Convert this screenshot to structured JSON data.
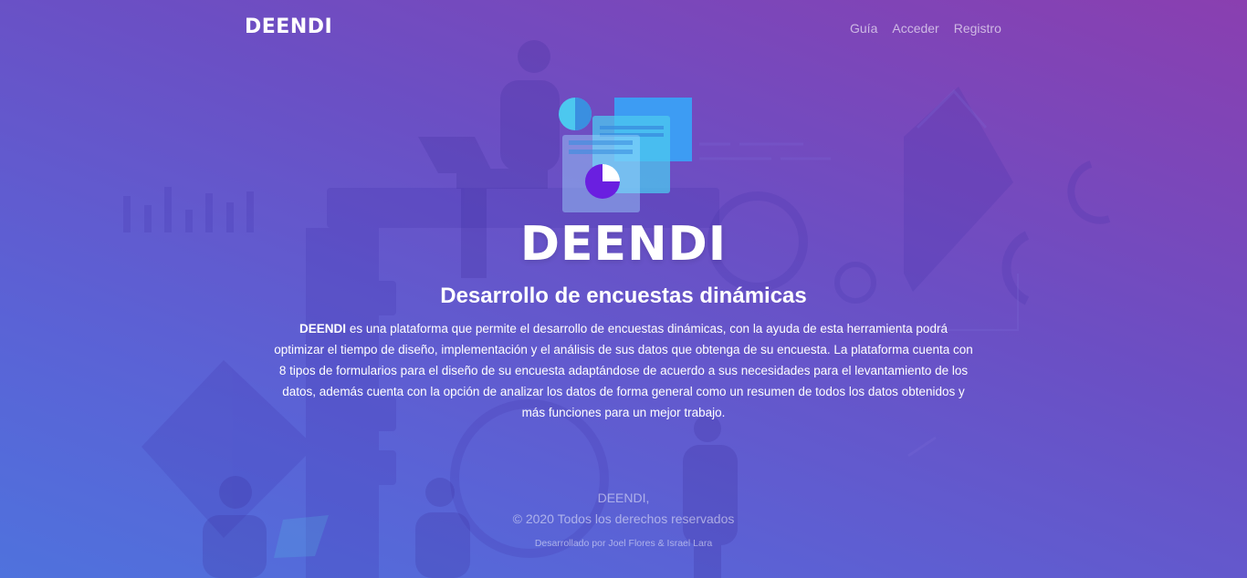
{
  "navbar": {
    "brand": "DEENDI",
    "links": [
      "Guía",
      "Acceder",
      "Registro"
    ]
  },
  "hero": {
    "title": "DEENDI",
    "subtitle": "Desarrollo de encuestas dinámicas",
    "description_strong": "DEENDI",
    "description_rest": " es una plataforma que permite el desarrollo de encuestas dinámicas, con la ayuda de esta herramienta podrá optimizar el tiempo de diseño, implementación y el análisis de sus datos que obtenga de su encuesta. La plataforma cuenta con 8 tipos de formularios para el diseño de su encuesta adaptándose de acuerdo a sus necesidades para el levantamiento de los datos, además cuenta con la opción de analizar los datos de forma general como un resumen de todos los datos obtenidos y más funciones para un mejor trabajo."
  },
  "footer": {
    "brand": "DEENDI,",
    "copyright": "© 2020 Todos los derechos reservados",
    "developers": "Desarrollado por Joel Flores & Israel Lara"
  },
  "colors": {
    "accent_blue": "#3aa0f5",
    "accent_cyan": "#4cc8ef",
    "accent_purple": "#6a1fe0"
  }
}
